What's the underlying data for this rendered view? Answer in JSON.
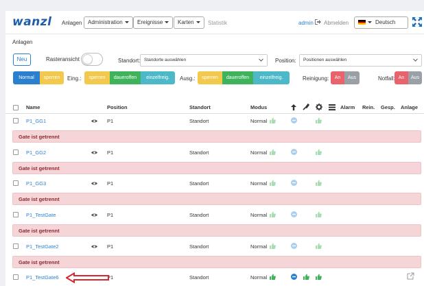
{
  "nav": {
    "brand": "wanzl",
    "anlagen": "Anlagen",
    "administration": "Administration",
    "ereignisse": "Ereignisse",
    "karten": "Karten",
    "statistik": "Statistik",
    "user": "admin",
    "logout": "Abmelden",
    "language": "Deutsch"
  },
  "section_title": "Anlagen",
  "filters": {
    "new_button": "Neu",
    "grid_view_label": "Rasteransicht",
    "location_label": "Standort:",
    "location_placeholder": "Standorte auswählen",
    "position_label": "Position:",
    "position_placeholder": "Positionen auswählen"
  },
  "mode_filters": {
    "normal": "Normal",
    "sperren": "sperren",
    "entry_label": "Eing.:",
    "entry": [
      "sperren",
      "daueroffen",
      "einzelfreig."
    ],
    "exit_label": "Ausg.:",
    "exit": [
      "sperren",
      "daueroffen",
      "einzelfreig."
    ],
    "cleaning_label": "Reinigung:",
    "emergency_label": "Notfall:",
    "on": "An",
    "off": "Aus"
  },
  "table": {
    "headers": {
      "name": "Name",
      "position": "Position",
      "location": "Standort",
      "mode": "Modus",
      "alarm": "Alarm",
      "cleaning": "Rein.",
      "locked": "Gesp.",
      "device": "Anlage"
    },
    "rows": [
      {
        "name": "P1_GG1",
        "position": "P1",
        "location": "Standort",
        "mode": "Normal",
        "alert": "Gate ist getrennt"
      },
      {
        "name": "P1_GG2",
        "position": "P1",
        "location": "Standort",
        "mode": "Normal",
        "alert": "Gate ist getrennt"
      },
      {
        "name": "P1_GG3",
        "position": "P1",
        "location": "Standort",
        "mode": "Normal",
        "alert": "Gate ist getrennt"
      },
      {
        "name": "P1_TestGate",
        "position": "P1",
        "location": "Standort",
        "mode": "Normal",
        "alert": "Gate ist getrennt"
      },
      {
        "name": "P1_TestGate2",
        "position": "P1",
        "location": "Standort",
        "mode": "Normal",
        "alert": "Gate ist getrennt"
      },
      {
        "name": "P1_TestGate6",
        "position": "P1",
        "location": "Standort",
        "mode": "Normal"
      }
    ]
  },
  "colors": {
    "primary": "#2a7fcf",
    "yellow": "#f2c94c",
    "green": "#3fb35b",
    "teal": "#4cb8c8",
    "red": "#e8636b",
    "grey": "#9aa0a6",
    "alert_bg": "#f6d5d8",
    "annotation_arrow": "#d9262e"
  }
}
